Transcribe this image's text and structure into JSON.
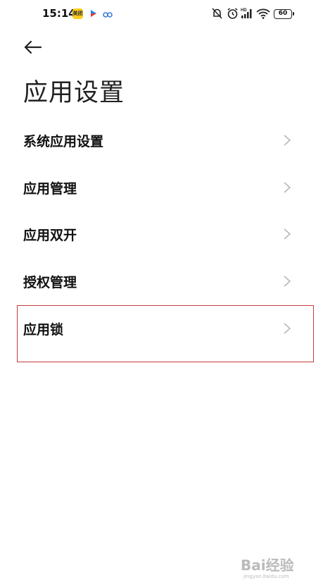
{
  "status_bar": {
    "time": "15:14",
    "meituan_label": "美团",
    "battery": "60",
    "icons": [
      "meituan-app-icon",
      "bilibili-app-icon",
      "cloud-app-icon",
      "notification-muted-icon",
      "alarm-icon",
      "hd-signal-icon",
      "wifi-icon",
      "battery-icon"
    ]
  },
  "header": {
    "back_icon": "back-arrow-icon",
    "title": "应用设置"
  },
  "menu": {
    "items": [
      {
        "label": "系统应用设置"
      },
      {
        "label": "应用管理"
      },
      {
        "label": "应用双开"
      },
      {
        "label": "授权管理"
      },
      {
        "label": "应用锁"
      }
    ],
    "highlighted_item": "应用锁",
    "highlight_color": "#c43b3b"
  },
  "watermark": {
    "text": "Bai经验",
    "sub": "jingyan.baidu.com"
  }
}
